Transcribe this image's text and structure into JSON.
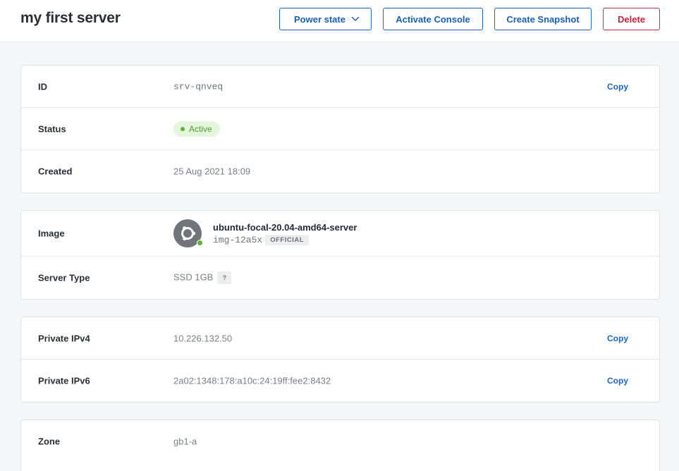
{
  "header": {
    "title": "my first server",
    "buttons": {
      "power_state": "Power state",
      "activate_console": "Activate Console",
      "create_snapshot": "Create Snapshot",
      "delete": "Delete"
    }
  },
  "details": {
    "id": {
      "label": "ID",
      "value": "srv-qnveq",
      "action": "Copy"
    },
    "status": {
      "label": "Status",
      "value": "Active"
    },
    "created": {
      "label": "Created",
      "value": "25 Aug 2021 18:09"
    }
  },
  "image": {
    "label": "Image",
    "name": "ubuntu-focal-20.04-amd64-server",
    "id": "img-12a5x",
    "badge": "OFFICIAL",
    "icon": "ubuntu-logo-icon"
  },
  "server_type": {
    "label": "Server Type",
    "value": "SSD 1GB",
    "help": "?"
  },
  "network": {
    "ipv4": {
      "label": "Private IPv4",
      "value": "10.226.132.50",
      "action": "Copy"
    },
    "ipv6": {
      "label": "Private IPv6",
      "value": "2a02:1348:178:a10c:24:19ff:fee2:8432",
      "action": "Copy"
    }
  },
  "zone": {
    "label": "Zone",
    "value": "gb1-a"
  },
  "colors": {
    "accent": "#1a66c2",
    "danger": "#c2203c",
    "status_active_bg": "#e4f6dc",
    "status_active_text": "#4f9a32"
  }
}
